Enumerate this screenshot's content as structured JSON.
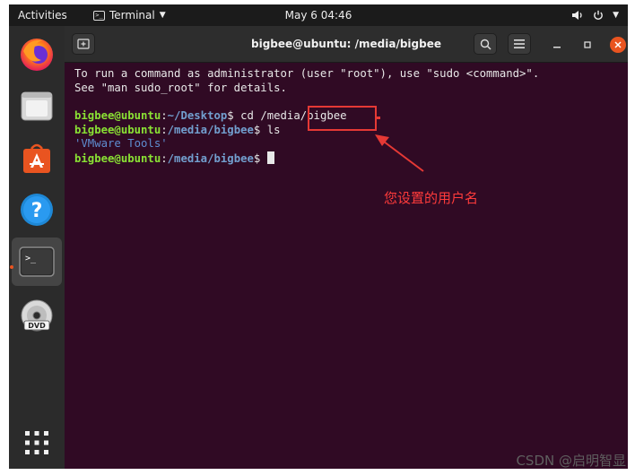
{
  "topbar": {
    "activities": "Activities",
    "app_name": "Terminal",
    "clock": "May 6  04:46",
    "colors": {
      "background": "#1b1b1b",
      "text": "#ececec"
    }
  },
  "dock": {
    "items": [
      {
        "name": "Firefox",
        "icon": "firefox-icon"
      },
      {
        "name": "Files",
        "icon": "files-icon"
      },
      {
        "name": "Ubuntu Software",
        "icon": "software-store-icon"
      },
      {
        "name": "Help",
        "icon": "help-icon"
      },
      {
        "name": "Terminal",
        "icon": "terminal-icon",
        "active": true
      },
      {
        "name": "DVD",
        "icon": "dvd-icon"
      }
    ],
    "show_apps_icon": "app-grid-icon"
  },
  "window": {
    "title": "bigbee@ubuntu: /media/bigbee",
    "colors": {
      "terminal_bg": "#300a24",
      "titlebar_bg": "#2d2d2d",
      "close": "#e95420"
    }
  },
  "terminal": {
    "intro_1": "To run a command as administrator (user \"root\"), use \"sudo <command>\".",
    "intro_2": "See \"man sudo_root\" for details.",
    "prompt_user": "bigbee@ubuntu",
    "sep": ":",
    "cwd_1": "~/Desktop",
    "cmd_1": "$ cd /media/bigbee",
    "cwd_2": "/media/bigbee",
    "cmd_2": "$ ls",
    "ls_output": "'VMware Tools'",
    "cwd_3": "/media/bigbee",
    "cmd_3": "$ ",
    "colors": {
      "user": "#8ae234",
      "path": "#729fcf",
      "text": "#e8e8e8"
    }
  },
  "annotation": {
    "text": "您设置的用户名",
    "color": "#e53935"
  },
  "watermark": "CSDN @启明智显"
}
